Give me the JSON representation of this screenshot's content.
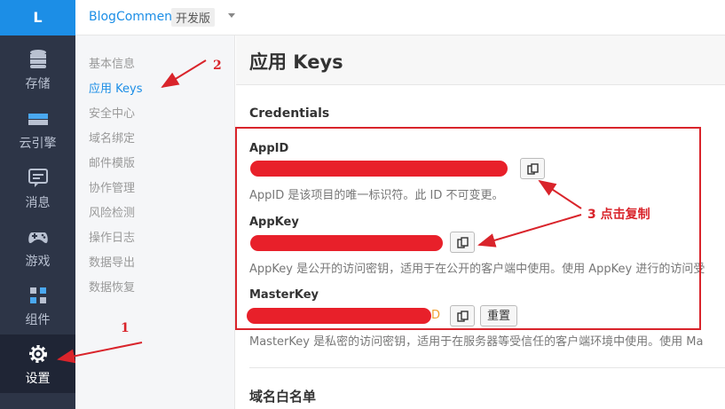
{
  "rail": {
    "logo": "L",
    "items": [
      {
        "label": "存储",
        "icon": "database-icon"
      },
      {
        "label": "云引擎",
        "icon": "cloud-engine-icon"
      },
      {
        "label": "消息",
        "icon": "message-icon"
      },
      {
        "label": "游戏",
        "icon": "gamepad-icon"
      },
      {
        "label": "组件",
        "icon": "components-icon"
      },
      {
        "label": "设置",
        "icon": "gear-icon",
        "active": true
      }
    ]
  },
  "header": {
    "app_name": "BlogComment",
    "env": "开发版"
  },
  "submenu": {
    "items": [
      "基本信息",
      "应用 Keys",
      "安全中心",
      "域名绑定",
      "邮件模版",
      "协作管理",
      "风险检测",
      "操作日志",
      "数据导出",
      "数据恢复"
    ],
    "active_index": 1
  },
  "main": {
    "title": "应用 Keys",
    "section": "Credentials",
    "app_id": {
      "label": "AppID",
      "help": "AppID 是该项目的唯一标识符。此 ID 不可变更。"
    },
    "app_key": {
      "label": "AppKey",
      "help": "AppKey 是公开的访问密钥，适用于在公开的客户端中使用。使用 AppKey 进行的访问受"
    },
    "master_key": {
      "label": "MasterKey",
      "value_tail": "D",
      "reset_label": "重置",
      "help": "MasterKey 是私密的访问密钥，适用于在服务器等受信任的客户端环境中使用。使用 Ma"
    },
    "whitelist_title": "域名白名单"
  },
  "annotations": {
    "n1": "1",
    "n2": "2",
    "n3": "3 点击复制",
    "color": "#d9242b"
  }
}
